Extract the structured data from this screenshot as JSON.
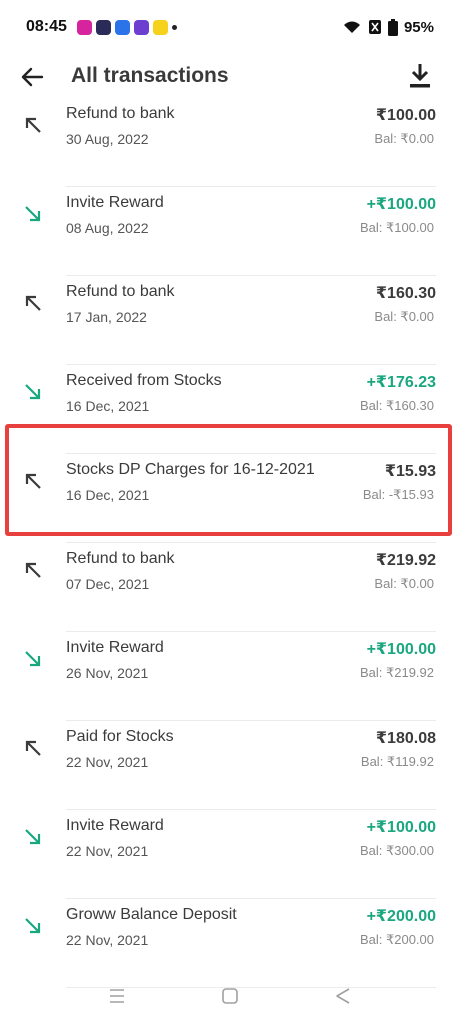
{
  "status_bar": {
    "time": "08:45",
    "battery_percent": "95%",
    "app_icons": [
      {
        "icon": "instagram-icon",
        "color": "#d6249f"
      },
      {
        "icon": "chart-app-icon",
        "color": "#2b2b5a"
      },
      {
        "icon": "b-app-icon",
        "color": "#2a73e8"
      },
      {
        "icon": "upi-app-icon",
        "color": "#6c3fd1"
      },
      {
        "icon": "flipkart-icon",
        "color": "#f7d21c"
      }
    ]
  },
  "header": {
    "title": "All transactions",
    "back_icon": "arrow-left-icon",
    "download_icon": "download-icon"
  },
  "colors": {
    "credit": "#1aa77f",
    "debit": "#3b3b3b",
    "highlight": "#e8403f"
  },
  "transactions": [
    {
      "name": "Refund to bank",
      "date": "30 Aug, 2022",
      "amount": "₹100.00",
      "balance": "Bal: ₹0.00",
      "type": "debit"
    },
    {
      "name": "Invite Reward",
      "date": "08 Aug, 2022",
      "amount": "+₹100.00",
      "balance": "Bal: ₹100.00",
      "type": "credit"
    },
    {
      "name": "Refund to bank",
      "date": "17 Jan, 2022",
      "amount": "₹160.30",
      "balance": "Bal: ₹0.00",
      "type": "debit"
    },
    {
      "name": "Received from Stocks",
      "date": "16 Dec, 2021",
      "amount": "+₹176.23",
      "balance": "Bal: ₹160.30",
      "type": "credit"
    },
    {
      "name": "Stocks DP Charges for 16-12-2021",
      "date": "16 Dec, 2021",
      "amount": "₹15.93",
      "balance": "Bal: -₹15.93",
      "type": "debit"
    },
    {
      "name": "Refund to bank",
      "date": "07 Dec, 2021",
      "amount": "₹219.92",
      "balance": "Bal: ₹0.00",
      "type": "debit"
    },
    {
      "name": "Invite Reward",
      "date": "26 Nov, 2021",
      "amount": "+₹100.00",
      "balance": "Bal: ₹219.92",
      "type": "credit"
    },
    {
      "name": "Paid for Stocks",
      "date": "22 Nov, 2021",
      "amount": "₹180.08",
      "balance": "Bal: ₹119.92",
      "type": "debit"
    },
    {
      "name": "Invite Reward",
      "date": "22 Nov, 2021",
      "amount": "+₹100.00",
      "balance": "Bal: ₹300.00",
      "type": "credit"
    },
    {
      "name": "Groww Balance Deposit",
      "date": "22 Nov, 2021",
      "amount": "+₹200.00",
      "balance": "Bal: ₹200.00",
      "type": "credit"
    }
  ],
  "nav_bar": {
    "recents_icon": "menu-lines-icon",
    "home_icon": "home-square-icon",
    "back_icon": "back-triangle-icon"
  }
}
